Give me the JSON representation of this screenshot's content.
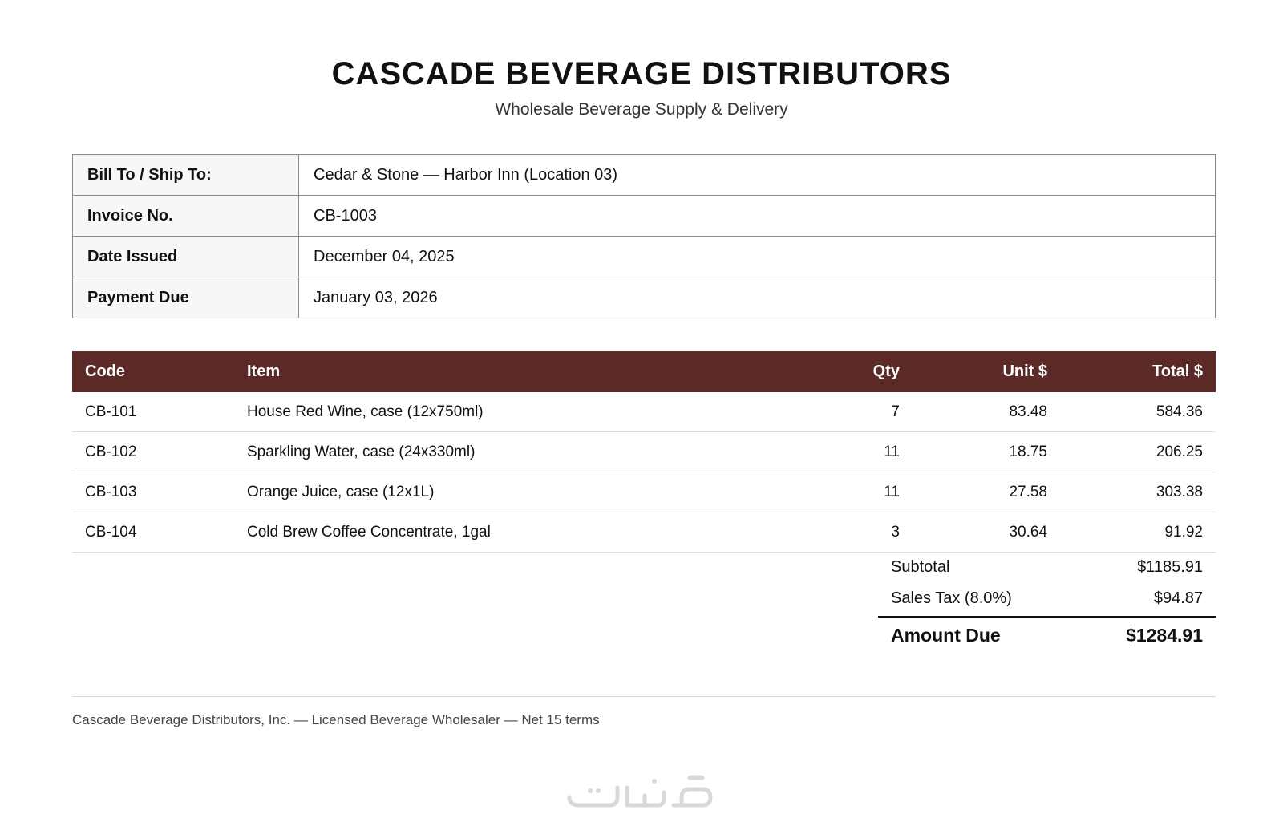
{
  "header": {
    "company_name": "CASCADE BEVERAGE DISTRIBUTORS",
    "tagline": "Wholesale Beverage Supply & Delivery"
  },
  "info": [
    {
      "label": "Bill To / Ship To:",
      "value": "Cedar & Stone — Harbor Inn (Location 03)"
    },
    {
      "label": "Invoice No.",
      "value": "CB-1003"
    },
    {
      "label": "Date Issued",
      "value": "December 04, 2025"
    },
    {
      "label": "Payment Due",
      "value": "January 03, 2026"
    }
  ],
  "items": {
    "headers": {
      "code": "Code",
      "item": "Item",
      "qty": "Qty",
      "unit": "Unit $",
      "total": "Total $"
    },
    "rows": [
      {
        "code": "CB-101",
        "item": "House Red Wine, case (12x750ml)",
        "qty": "7",
        "unit": "83.48",
        "total": "584.36"
      },
      {
        "code": "CB-102",
        "item": "Sparkling Water, case (24x330ml)",
        "qty": "11",
        "unit": "18.75",
        "total": "206.25"
      },
      {
        "code": "CB-103",
        "item": "Orange Juice, case (12x1L)",
        "qty": "11",
        "unit": "27.58",
        "total": "303.38"
      },
      {
        "code": "CB-104",
        "item": "Cold Brew Coffee Concentrate, 1gal",
        "qty": "3",
        "unit": "30.64",
        "total": "91.92"
      }
    ]
  },
  "totals": {
    "subtotal_label": "Subtotal",
    "subtotal_value": "$1185.91",
    "tax_label": "Sales Tax (8.0%)",
    "tax_value": "$94.87",
    "due_label": "Amount Due",
    "due_value": "$1284.91"
  },
  "footer": {
    "text": "Cascade Beverage Distributors, Inc. — Licensed Beverage Wholesaler — Net 15 terms"
  },
  "watermark": {
    "text": "خمسات"
  },
  "colors": {
    "header_row_bg": "#5b2a26",
    "label_bg": "#f7f7f7"
  }
}
